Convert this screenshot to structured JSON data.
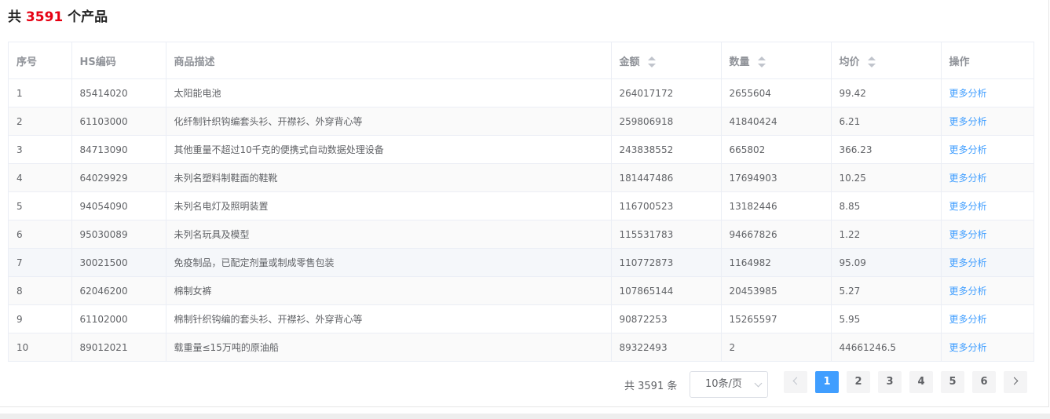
{
  "heading": {
    "prefix": "共",
    "count": "3591",
    "suffix": "个产品"
  },
  "colors": {
    "accent": "#409eff",
    "count_red": "#e60012",
    "header_text": "#909399"
  },
  "table": {
    "columns": [
      {
        "label": "序号",
        "sortable": false
      },
      {
        "label": "HS编码",
        "sortable": false
      },
      {
        "label": "商品描述",
        "sortable": false
      },
      {
        "label": "金额",
        "sortable": true
      },
      {
        "label": "数量",
        "sortable": true
      },
      {
        "label": "均价",
        "sortable": true
      },
      {
        "label": "操作",
        "sortable": false
      }
    ],
    "rows": [
      {
        "index": "1",
        "hs": "85414020",
        "desc": "太阳能电池",
        "amount": "264017172",
        "qty": "2655604",
        "avg": "99.42",
        "action": "更多分析"
      },
      {
        "index": "2",
        "hs": "61103000",
        "desc": "化纤制针织钩编套头衫、开襟衫、外穿背心等",
        "amount": "259806918",
        "qty": "41840424",
        "avg": "6.21",
        "action": "更多分析"
      },
      {
        "index": "3",
        "hs": "84713090",
        "desc": "其他重量不超过10千克的便携式自动数据处理设备",
        "amount": "243838552",
        "qty": "665802",
        "avg": "366.23",
        "action": "更多分析"
      },
      {
        "index": "4",
        "hs": "64029929",
        "desc": "未列名塑料制鞋面的鞋靴",
        "amount": "181447486",
        "qty": "17694903",
        "avg": "10.25",
        "action": "更多分析"
      },
      {
        "index": "5",
        "hs": "94054090",
        "desc": "未列名电灯及照明装置",
        "amount": "116700523",
        "qty": "13182446",
        "avg": "8.85",
        "action": "更多分析"
      },
      {
        "index": "6",
        "hs": "95030089",
        "desc": "未列名玩具及模型",
        "amount": "115531783",
        "qty": "94667826",
        "avg": "1.22",
        "action": "更多分析"
      },
      {
        "index": "7",
        "hs": "30021500",
        "desc": "免疫制品，已配定剂量或制成零售包装",
        "amount": "110772873",
        "qty": "1164982",
        "avg": "95.09",
        "action": "更多分析"
      },
      {
        "index": "8",
        "hs": "62046200",
        "desc": "棉制女裤",
        "amount": "107865144",
        "qty": "20453985",
        "avg": "5.27",
        "action": "更多分析"
      },
      {
        "index": "9",
        "hs": "61102000",
        "desc": "棉制针织钩编的套头衫、开襟衫、外穿背心等",
        "amount": "90872253",
        "qty": "15265597",
        "avg": "5.95",
        "action": "更多分析"
      },
      {
        "index": "10",
        "hs": "89012021",
        "desc": "载重量≤15万吨的原油船",
        "amount": "89322493",
        "qty": "2",
        "avg": "44661246.5",
        "action": "更多分析"
      }
    ]
  },
  "pagination": {
    "total_text": "共 3591 条",
    "page_size": "10条/页",
    "pages": [
      "1",
      "2",
      "3",
      "4",
      "5",
      "6"
    ],
    "current_page": "1"
  }
}
